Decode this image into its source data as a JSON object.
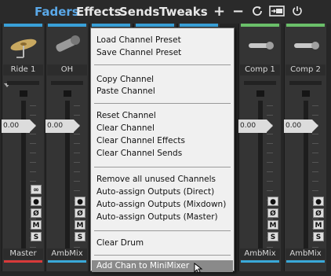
{
  "toolbar": {
    "tabs": [
      {
        "label": "Faders",
        "active": true
      },
      {
        "label": "Effects"
      },
      {
        "label": "Sends"
      },
      {
        "label": "Tweaks"
      }
    ],
    "plus": "+",
    "minus": "−",
    "refresh_icon": "refresh-icon",
    "monitor_icon": "monitor-icon",
    "power_icon": "power-icon"
  },
  "strips": [
    {
      "name": "Ride 1",
      "icon": "cymbal-icon",
      "color": "#39a0d8",
      "output": "Master",
      "out_color": "#d83a3a",
      "volume": "0.00"
    },
    {
      "name": "OH",
      "icon": "microphone-icon",
      "color": "#39a0d8",
      "output": "AmbMix",
      "out_color": "#3aa8d8",
      "volume": "0.00"
    },
    {
      "name": "",
      "icon": "microphone-icon",
      "color": "#39a0d8",
      "output": "",
      "out_color": "#3aa8d8",
      "volume": ""
    },
    {
      "name": "",
      "icon": "microphone-icon",
      "color": "#39a0d8",
      "output": "",
      "out_color": "#3aa8d8",
      "volume": ""
    },
    {
      "name": "",
      "icon": "microphone-icon",
      "color": "#39a0d8",
      "output": "",
      "out_color": "#3aa8d8",
      "volume": ""
    },
    {
      "name": "Comp 1",
      "icon": "microphone-icon",
      "color": "#6abf69",
      "output": "AmbMix",
      "out_color": "#3aa8d8",
      "volume": "0.00"
    },
    {
      "name": "Comp 2",
      "icon": "microphone-icon",
      "color": "#6abf69",
      "output": "AmbMix",
      "out_color": "#3aa8d8",
      "volume": "0.00"
    }
  ],
  "button_labels": {
    "link": "∞",
    "record": "●",
    "phase": "Ø",
    "mute": "M",
    "solo": "S"
  },
  "menu": {
    "items": [
      {
        "label": "Load Channel Preset"
      },
      {
        "label": "Save Channel Preset"
      },
      {
        "label": "Copy Channel"
      },
      {
        "label": "Paste Channel"
      },
      {
        "label": "Reset Channel"
      },
      {
        "label": "Clear Channel"
      },
      {
        "label": "Clear Channel Effects"
      },
      {
        "label": "Clear Channel Sends"
      },
      {
        "label": "Remove all unused Channels"
      },
      {
        "label": "Auto-assign Outputs (Direct)"
      },
      {
        "label": "Auto-assign Outputs (Mixdown)"
      },
      {
        "label": "Auto-assign Outputs (Master)"
      },
      {
        "label": "Clear Drum"
      },
      {
        "label": "Add Chan to MiniMixer",
        "highlighted": true
      }
    ]
  }
}
